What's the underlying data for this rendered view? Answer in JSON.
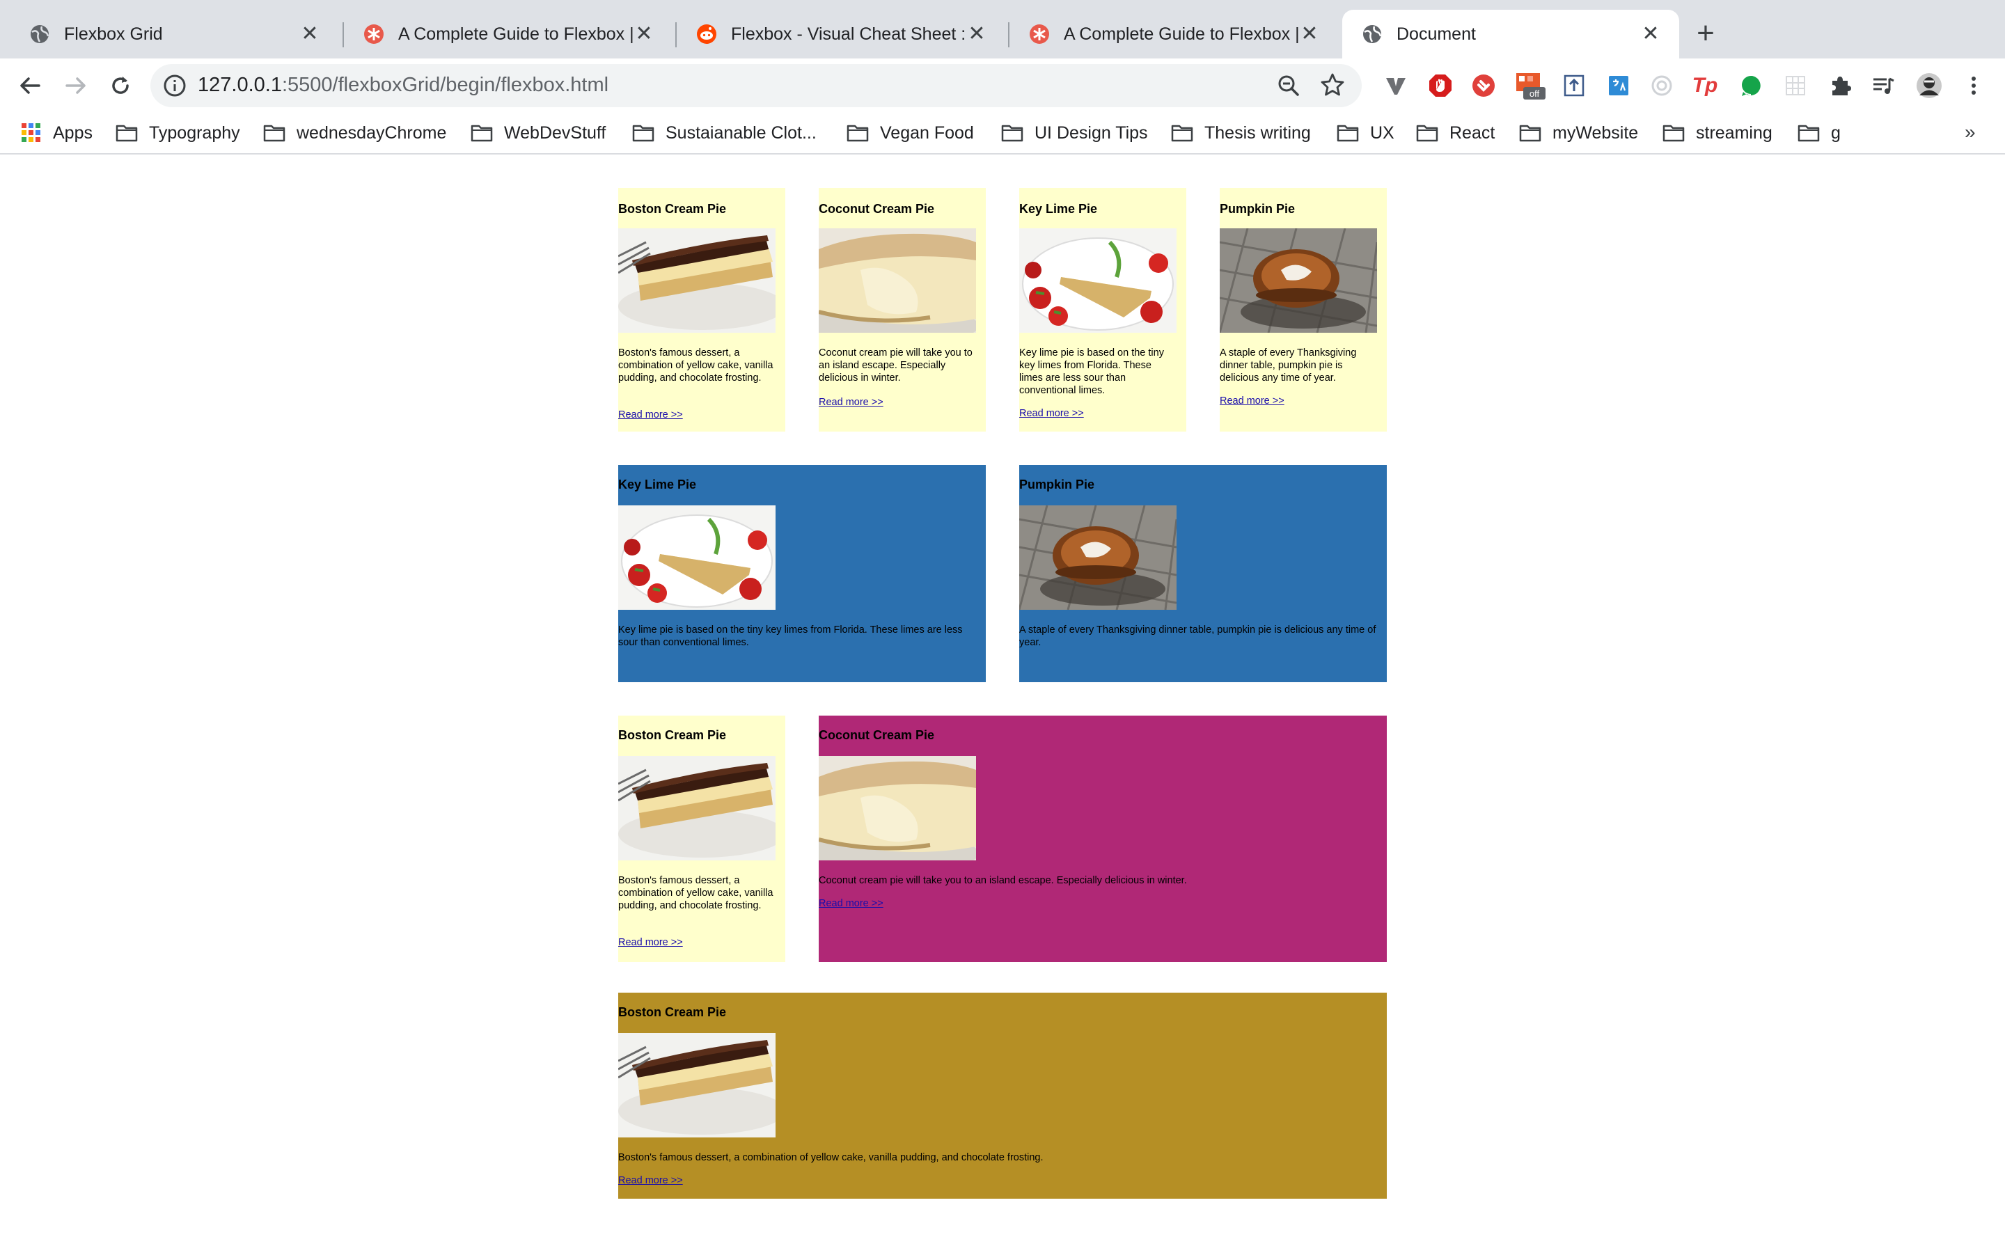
{
  "browser": {
    "tabs": [
      {
        "title": "Flexbox Grid",
        "favicon": "globe-icon"
      },
      {
        "title": "A Complete Guide to Flexbox |",
        "favicon": "css-tricks-icon"
      },
      {
        "title": "Flexbox - Visual Cheat Sheet :",
        "favicon": "reddit-icon"
      },
      {
        "title": "A Complete Guide to Flexbox |",
        "favicon": "css-tricks-icon"
      },
      {
        "title": "Document",
        "favicon": "globe-icon"
      }
    ],
    "new_tab_label": "+",
    "address": {
      "host": "127.0.0.1",
      "rest": ":5500/flexboxGrid/begin/flexbox.html"
    },
    "extensions": [
      "vimium-icon",
      "adblock-icon",
      "pocket-icon",
      "wappalyzer-off-icon",
      "upload-icon",
      "translate-icon",
      "spinner-icon",
      "tp-icon",
      "grammarly-icon",
      "grid-icon",
      "puzzle-icon",
      "playlist-icon",
      "avatar-icon",
      "kebab-menu-icon"
    ],
    "extension_badge": "off",
    "extension_tp": "Tp",
    "bookmarks": [
      "Apps",
      "Typography",
      "wednesdayChrome",
      "WebDevStuff",
      "Sustaianable Clot...",
      "Vegan Food",
      "UI Design Tips",
      "Thesis writing",
      "UX",
      "React",
      "myWebsite",
      "streaming",
      "g"
    ],
    "bookmarks_more": "»"
  },
  "colors": {
    "yellow_card": "#ffffcc",
    "blue_card": "#2b70af",
    "magenta_card": "#b02876",
    "gold_card": "#b58f25",
    "link": "#1a0dab"
  },
  "cards": [
    {
      "title": "Boston Cream Pie",
      "image": "boston-cream-pie",
      "desc": "Boston's famous dessert, a combination of yellow cake, vanilla pudding, and chocolate frosting.",
      "link": "Read more >>"
    },
    {
      "title": "Coconut Cream Pie",
      "image": "coconut-cream-pie",
      "desc": "Coconut cream pie will take you to an island escape. Especially delicious in winter.",
      "link": "Read more >>"
    },
    {
      "title": "Key Lime Pie",
      "image": "key-lime-pie",
      "desc": "Key lime pie is based on the tiny key limes from Florida. These limes are less sour than conventional limes.",
      "link": "Read more >>"
    },
    {
      "title": "Pumpkin Pie",
      "image": "pumpkin-pie",
      "desc": "A staple of every Thanksgiving dinner table, pumpkin pie is delicious any time of year.",
      "link": "Read more >>"
    },
    {
      "title": "Key Lime Pie",
      "image": "key-lime-pie",
      "desc": "Key lime pie is based on the tiny key limes from Florida. These limes are less sour than conventional limes."
    },
    {
      "title": "Pumpkin Pie",
      "image": "pumpkin-pie",
      "desc": "A staple of every Thanksgiving dinner table, pumpkin pie is delicious any time of year."
    },
    {
      "title": "Boston Cream Pie",
      "image": "boston-cream-pie",
      "desc": "Boston's famous dessert, a combination of yellow cake, vanilla pudding, and chocolate frosting.",
      "link": "Read more >>"
    },
    {
      "title": "Coconut Cream Pie",
      "image": "coconut-cream-pie",
      "desc": "Coconut cream pie will take you to an island escape. Especially delicious in winter.",
      "link": "Read more >>"
    },
    {
      "title": "Boston Cream Pie",
      "image": "boston-cream-pie",
      "desc": "Boston's famous dessert, a combination of yellow cake, vanilla pudding, and chocolate frosting.",
      "link": "Read more >>"
    }
  ]
}
